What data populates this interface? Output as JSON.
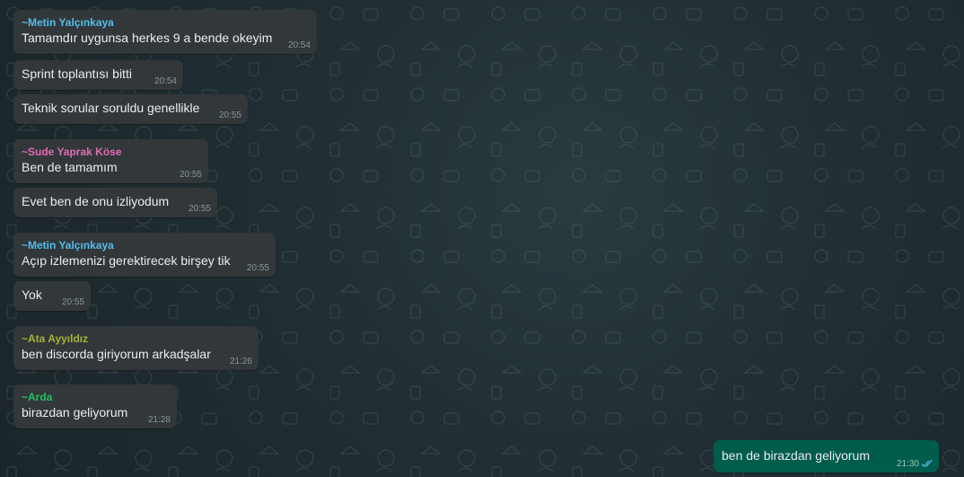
{
  "messages": [
    {
      "sender": "~Metin Yalçınkaya",
      "sender_color": "#53bdeb",
      "text": "Tamamdır uygunsa herkes 9 a bende okeyim",
      "time": "20:54"
    },
    {
      "sender": "",
      "text": "Sprint toplantısı bitti",
      "time": "20:54"
    },
    {
      "sender": "",
      "text": "Teknik sorular soruldu genellikle",
      "time": "20:55"
    },
    {
      "sender": "~Sude Yaprak Köse",
      "sender_color": "#e26ab6",
      "text": "Ben de tamamım",
      "time": "20:55"
    },
    {
      "sender": "",
      "text": "Evet ben de onu izliyodum",
      "time": "20:55"
    },
    {
      "sender": "~Metin Yalçınkaya",
      "sender_color": "#53bdeb",
      "text": "Açıp izlemenizi gerektirecek birşey tik",
      "time": "20:55"
    },
    {
      "sender": "",
      "text": "Yok",
      "time": "20:55"
    },
    {
      "sender": "~Ata Ayyıldız",
      "sender_color": "#a5b337",
      "text": "ben discorda giriyorum arkadşalar",
      "time": "21:26"
    },
    {
      "sender": "~Arda",
      "sender_color": "#21c063",
      "text": "birazdan geliyorum",
      "time": "21:28"
    }
  ],
  "outgoing": {
    "text": "ben de birazdan geliyorum",
    "time": "21:30",
    "status_icon": "double-check-read-icon",
    "tick_color": "#53bdeb"
  }
}
